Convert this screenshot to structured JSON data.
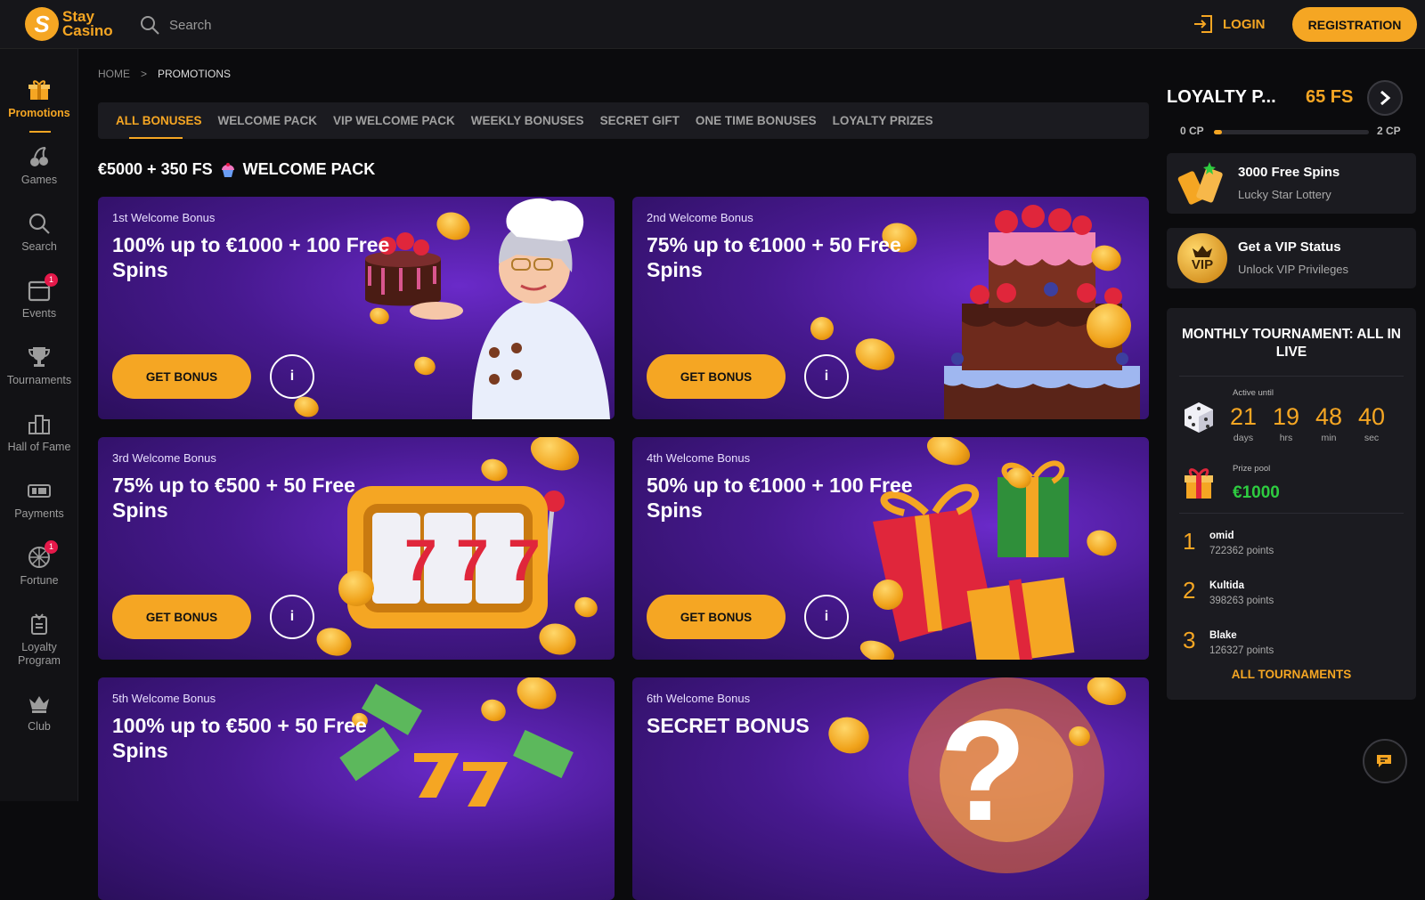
{
  "header": {
    "logo_line1": "Stay",
    "logo_line2": "Casino",
    "logo_mark": "S",
    "search_placeholder": "Search",
    "login_label": "LOGIN",
    "registration_label": "REGISTRATION"
  },
  "sidebar": {
    "items": [
      {
        "label": "Promotions",
        "icon": "gift-icon",
        "active": true
      },
      {
        "label": "Games",
        "icon": "cherry-icon"
      },
      {
        "label": "Search",
        "icon": "search-icon"
      },
      {
        "label": "Events",
        "icon": "calendar-icon",
        "badge": "1"
      },
      {
        "label": "Tournaments",
        "icon": "trophy-icon"
      },
      {
        "label": "Hall of Fame",
        "icon": "podium-icon"
      },
      {
        "label": "Payments",
        "icon": "wallet-icon"
      },
      {
        "label": "Fortune",
        "icon": "wheel-icon",
        "badge": "1"
      },
      {
        "label": "Loyalty Program",
        "icon": "loyalty-icon"
      },
      {
        "label": "Club",
        "icon": "crown-icon"
      }
    ]
  },
  "breadcrumb": {
    "home": "HOME",
    "separator": ">",
    "current": "PROMOTIONS"
  },
  "tabs": [
    "ALL BONUSES",
    "WELCOME PACK",
    "VIP WELCOME PACK",
    "WEEKLY BONUSES",
    "SECRET GIFT",
    "ONE TIME BONUSES",
    "LOYALTY PRIZES"
  ],
  "section_title": {
    "amount": "€5000 + 350 FS",
    "label": "WELCOME PACK",
    "icon": "cupcake-icon"
  },
  "cards": [
    {
      "sub": "1st Welcome Bonus",
      "head": "100% up to €1000 + 100 Free Spins",
      "button": "GET BONUS",
      "info": "i"
    },
    {
      "sub": "2nd Welcome Bonus",
      "head": "75% up to €1000 + 50 Free Spins",
      "button": "GET BONUS",
      "info": "i"
    },
    {
      "sub": "3rd Welcome Bonus",
      "head": "75% up to €500 + 50 Free Spins",
      "button": "GET BONUS",
      "info": "i",
      "slot": "7"
    },
    {
      "sub": "4th Welcome Bonus",
      "head": "50% up to €1000 + 100 Free Spins",
      "button": "GET BONUS",
      "info": "i"
    },
    {
      "sub": "5th Welcome Bonus",
      "head": "100% up to €500 + 50 Free Spins"
    },
    {
      "sub": "6th Welcome Bonus",
      "head": "SECRET BONUS",
      "mystery": "?"
    }
  ],
  "loyalty": {
    "title": "LOYALTY P...",
    "fs": "65 FS",
    "cp_min": "0 CP",
    "cp_max": "2 CP",
    "progress": 0.05
  },
  "promo_cards": [
    {
      "title": "3000 Free Spins",
      "subtitle": "Lucky Star Lottery",
      "icon": "tickets-icon"
    },
    {
      "title": "Get a VIP Status",
      "subtitle": "Unlock VIP Privileges",
      "icon": "vip-icon",
      "icon_text": "VIP"
    }
  ],
  "tournament": {
    "title": "MONTHLY TOURNAMENT: ALL IN LIVE",
    "active_until": "Active until",
    "countdown": [
      {
        "n": "21",
        "l": "days"
      },
      {
        "n": "19",
        "l": "hrs"
      },
      {
        "n": "48",
        "l": "min"
      },
      {
        "n": "40",
        "l": "sec"
      }
    ],
    "prize_pool_label": "Prize pool",
    "prize_pool": "€1000",
    "leaders": [
      {
        "rank": "1",
        "name": "omid",
        "points": "722362 points"
      },
      {
        "rank": "2",
        "name": "Kultida",
        "points": "398263 points"
      },
      {
        "rank": "3",
        "name": "Blake",
        "points": "126327 points"
      }
    ],
    "all_link": "ALL TOURNAMENTS"
  },
  "colors": {
    "accent": "#f5a623",
    "bg": "#0b0b0d",
    "panel": "#1b1b20",
    "card_purple": "#47198f",
    "prize_green": "#2ecc40"
  }
}
